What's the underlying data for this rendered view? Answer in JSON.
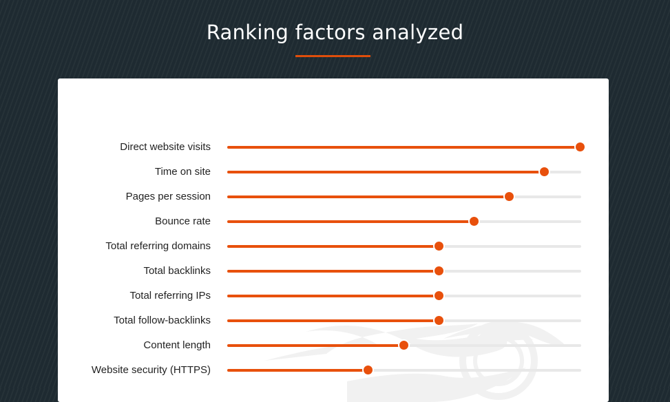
{
  "header": {
    "title": "Ranking factors analyzed"
  },
  "colors": {
    "accent": "#e8500c",
    "track": "#e8e8e8",
    "background": "#1e2a31",
    "card": "#ffffff",
    "label_text": "#222222"
  },
  "chart_data": {
    "type": "bar",
    "orientation": "horizontal",
    "title": "Ranking factors analyzed",
    "xlabel": "",
    "ylabel": "",
    "xlim": [
      0,
      1
    ],
    "grid": false,
    "legend": "none",
    "categories": [
      "Direct website visits",
      "Time on site",
      "Pages per session",
      "Bounce rate",
      "Total referring domains",
      "Total backlinks",
      "Total referring IPs",
      "Total follow-backlinks",
      "Content length",
      "Website security (HTTPS)"
    ],
    "values": [
      1.0,
      0.9,
      0.8,
      0.7,
      0.6,
      0.6,
      0.6,
      0.6,
      0.5,
      0.4
    ]
  }
}
